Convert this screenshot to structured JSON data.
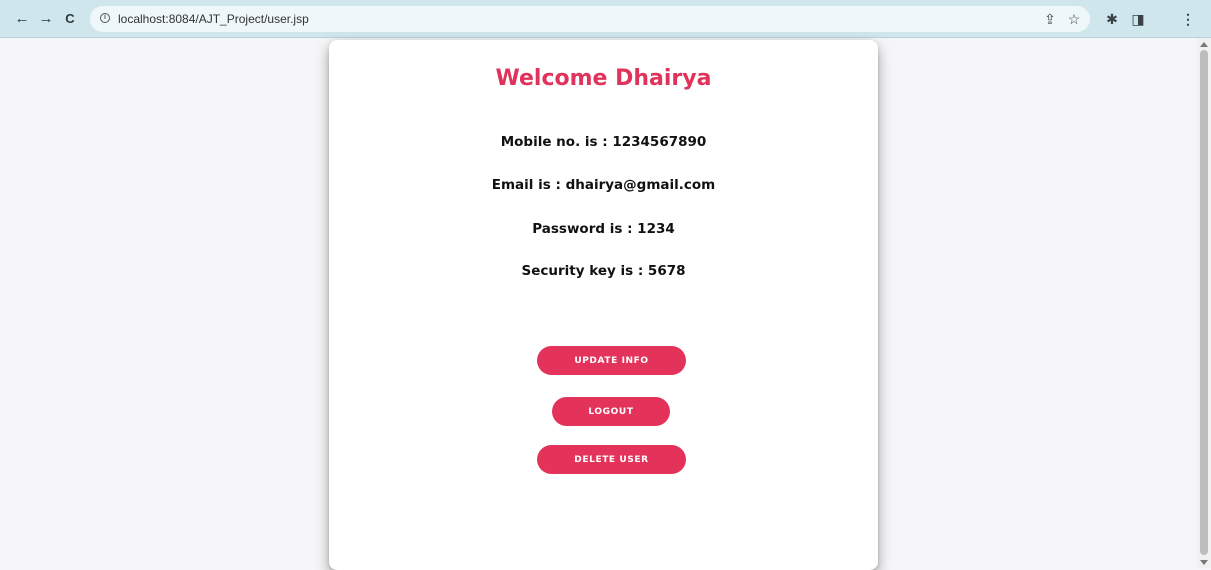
{
  "browser": {
    "url": "localhost:8084/AJT_Project/user.jsp",
    "back_glyph": "←",
    "forward_glyph": "→",
    "reload_glyph": "C",
    "info_glyph": "i",
    "share_glyph": "⇪",
    "star_glyph": "☆",
    "extensions_glyph": "✱",
    "sidepanel_glyph": "◨",
    "menu_glyph": "⋮"
  },
  "card": {
    "title": "Welcome Dhairya",
    "mobile": "Mobile no. is : 1234567890",
    "email": "Email is : dhairya@gmail.com",
    "password": "Password is : 1234",
    "security_key": "Security key is : 5678"
  },
  "buttons": {
    "update": "UPDATE INFO",
    "logout": "LOGOUT",
    "delete": "DELETE USER"
  },
  "colors": {
    "accent": "#e3335b",
    "browser_bar": "#cfe7ec"
  }
}
